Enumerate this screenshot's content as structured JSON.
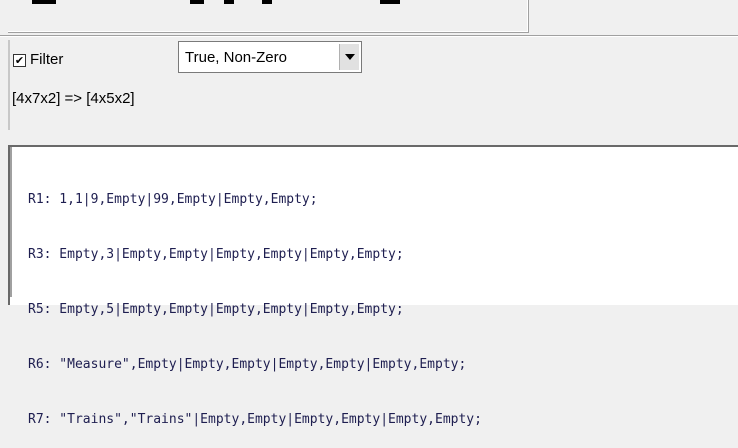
{
  "filter": {
    "checked": true,
    "check_mark": "✔",
    "label": "Filter",
    "combo_value": "True, Non-Zero"
  },
  "shape_transform": "[4x7x2] => [4x5x2]",
  "result_rows": [
    "R1: 1,1|9,Empty|99,Empty|Empty,Empty;",
    "R3: Empty,3|Empty,Empty|Empty,Empty|Empty,Empty;",
    "R5: Empty,5|Empty,Empty|Empty,Empty|Empty,Empty;",
    "R6: \"Measure\",Empty|Empty,Empty|Empty,Empty|Empty,Empty;",
    "R7: \"Trains\",\"Trains\"|Empty,Empty|Empty,Empty|Empty,Empty;"
  ]
}
